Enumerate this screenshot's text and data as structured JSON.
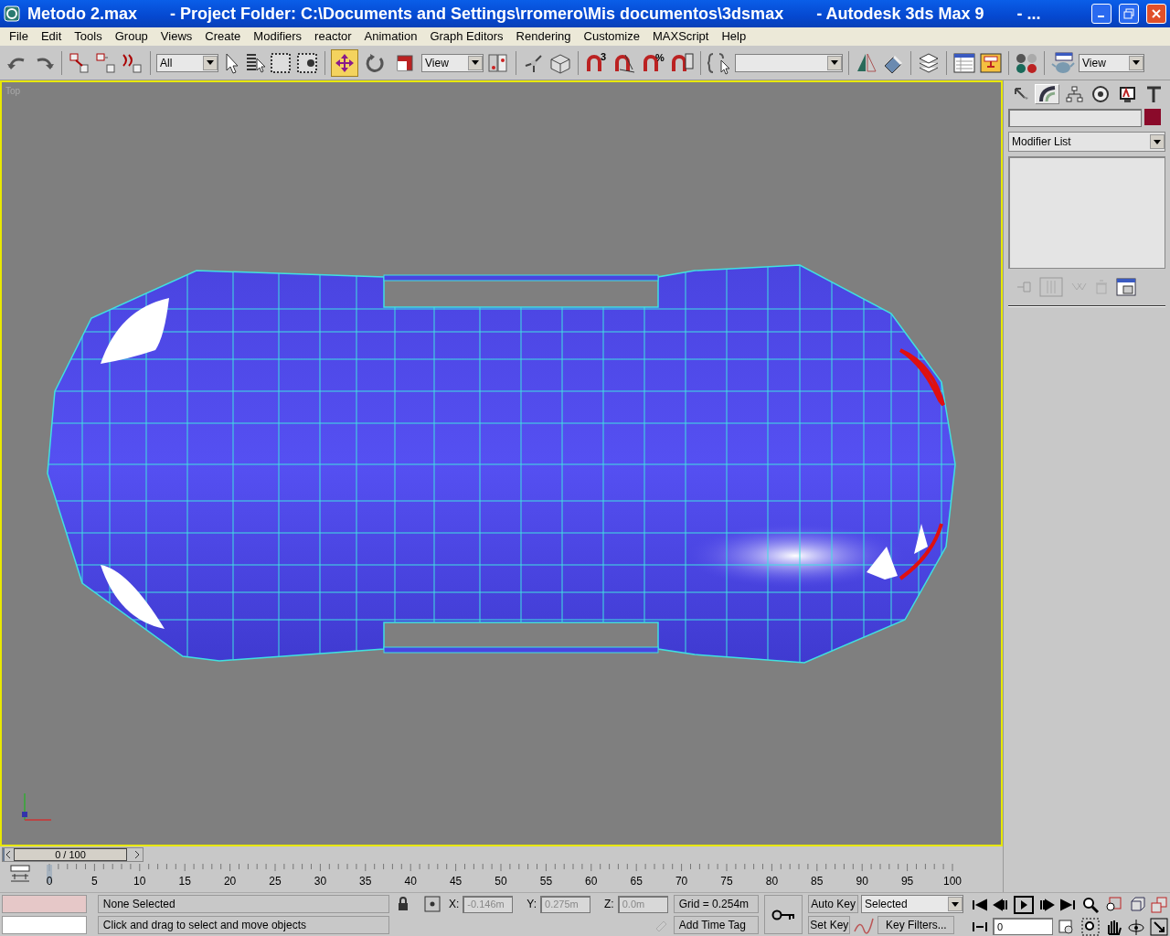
{
  "window": {
    "file": "Metodo 2.max",
    "project": "- Project Folder: C:\\Documents and Settings\\rromero\\Mis documentos\\3dsmax",
    "app": "- Autodesk 3ds Max 9",
    "more": "- ..."
  },
  "menu": [
    "File",
    "Edit",
    "Tools",
    "Group",
    "Views",
    "Create",
    "Modifiers",
    "reactor",
    "Animation",
    "Graph Editors",
    "Rendering",
    "Customize",
    "MAXScript",
    "Help"
  ],
  "toolbar": {
    "selection_filter": "All",
    "reference_coordinates": "View",
    "render_type": "View",
    "snap_labels": [
      "3",
      "%"
    ],
    "transform_tools": [
      {
        "selected": true
      },
      {
        "selected": false
      },
      {
        "selected": false
      }
    ]
  },
  "viewport": {
    "label": "Top"
  },
  "command_panel": {
    "tabs": [
      {
        "selected": false
      },
      {
        "selected": true
      },
      {
        "selected": false
      },
      {
        "selected": false
      },
      {
        "selected": false
      },
      {
        "selected": false
      }
    ],
    "modifier_list": "Modifier List"
  },
  "time_slider": {
    "label": "0 / 100",
    "level": 0
  },
  "ruler": [
    "0",
    "5",
    "10",
    "15",
    "20",
    "25",
    "30",
    "35",
    "40",
    "45",
    "50",
    "55",
    "60",
    "65",
    "70",
    "75",
    "80",
    "85",
    "90",
    "95",
    "100"
  ],
  "status": {
    "selection": "None Selected",
    "prompt": "Click and drag to select and move objects",
    "x_label": "X:",
    "y_label": "Y:",
    "z_label": "Z:",
    "x": "-0.146m",
    "y": "0.275m",
    "z": "0.0m",
    "grid": "Grid = 0.254m",
    "time_tag": "Add Time Tag",
    "auto_key": "Auto Key",
    "set_key": "Set Key",
    "key_mode": "Selected",
    "key_filters": "Key Filters...",
    "frame": "0"
  }
}
